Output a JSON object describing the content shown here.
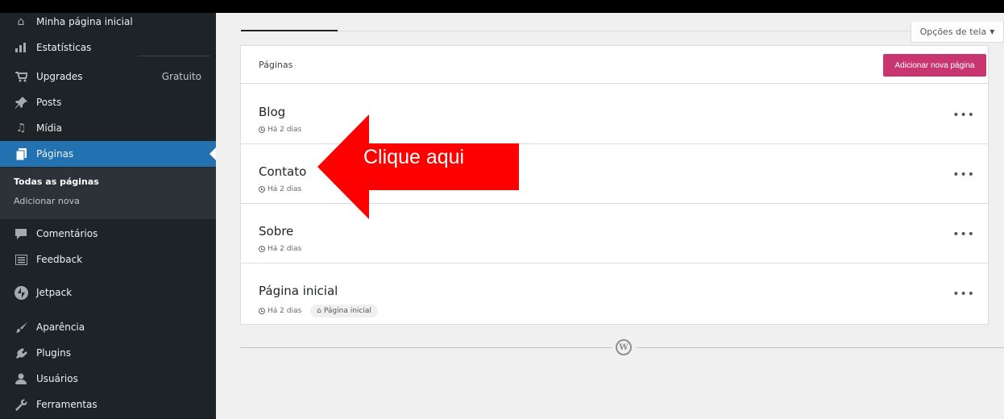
{
  "sidebar": {
    "items": [
      {
        "icon": "home-icon",
        "glyph": "⌂",
        "label": "Minha página inicial"
      },
      {
        "icon": "stats-icon",
        "glyph": "▮",
        "label": "Estatísticas"
      },
      {
        "icon": "cart-icon",
        "glyph": "🛒",
        "label": "Upgrades",
        "badge": "Gratuito"
      },
      {
        "icon": "pin-icon",
        "glyph": "✎",
        "label": "Posts"
      },
      {
        "icon": "media-icon",
        "glyph": "♫",
        "label": "Mídia"
      },
      {
        "icon": "pages-icon",
        "glyph": "▤",
        "label": "Páginas"
      },
      {
        "icon": "comments-icon",
        "glyph": "▬",
        "label": "Comentários"
      },
      {
        "icon": "feedback-icon",
        "glyph": "☰",
        "label": "Feedback"
      },
      {
        "icon": "jetpack-icon",
        "glyph": "⚡",
        "label": "Jetpack"
      },
      {
        "icon": "brush-icon",
        "glyph": "✐",
        "label": "Aparência"
      },
      {
        "icon": "plugin-icon",
        "glyph": "⚙",
        "label": "Plugins"
      },
      {
        "icon": "user-icon",
        "glyph": "●",
        "label": "Usuários"
      },
      {
        "icon": "wrench-icon",
        "glyph": "🔧",
        "label": "Ferramentas"
      }
    ],
    "submenu": {
      "current": "Todas as páginas",
      "other": "Adicionar nova"
    }
  },
  "screen_options": {
    "label": "Opções de tela",
    "arrow": "▼"
  },
  "card": {
    "title": "Páginas",
    "add_button": "Adicionar nova página",
    "rows": [
      {
        "title": "Blog",
        "meta": "Há 2 dias"
      },
      {
        "title": "Contato",
        "meta": "Há 2 dias"
      },
      {
        "title": "Sobre",
        "meta": "Há 2 dias"
      },
      {
        "title": "Página inicial",
        "meta": "Há 2 dias",
        "badge": "Página inicial"
      }
    ],
    "more_label": "•••"
  },
  "annotation": {
    "text": "Clique aqui",
    "color": "#ff0000"
  },
  "footer": {
    "logo": "W"
  },
  "colors": {
    "sidebar": "#1d2327",
    "active": "#2271b1",
    "accent": "#c9356e"
  }
}
